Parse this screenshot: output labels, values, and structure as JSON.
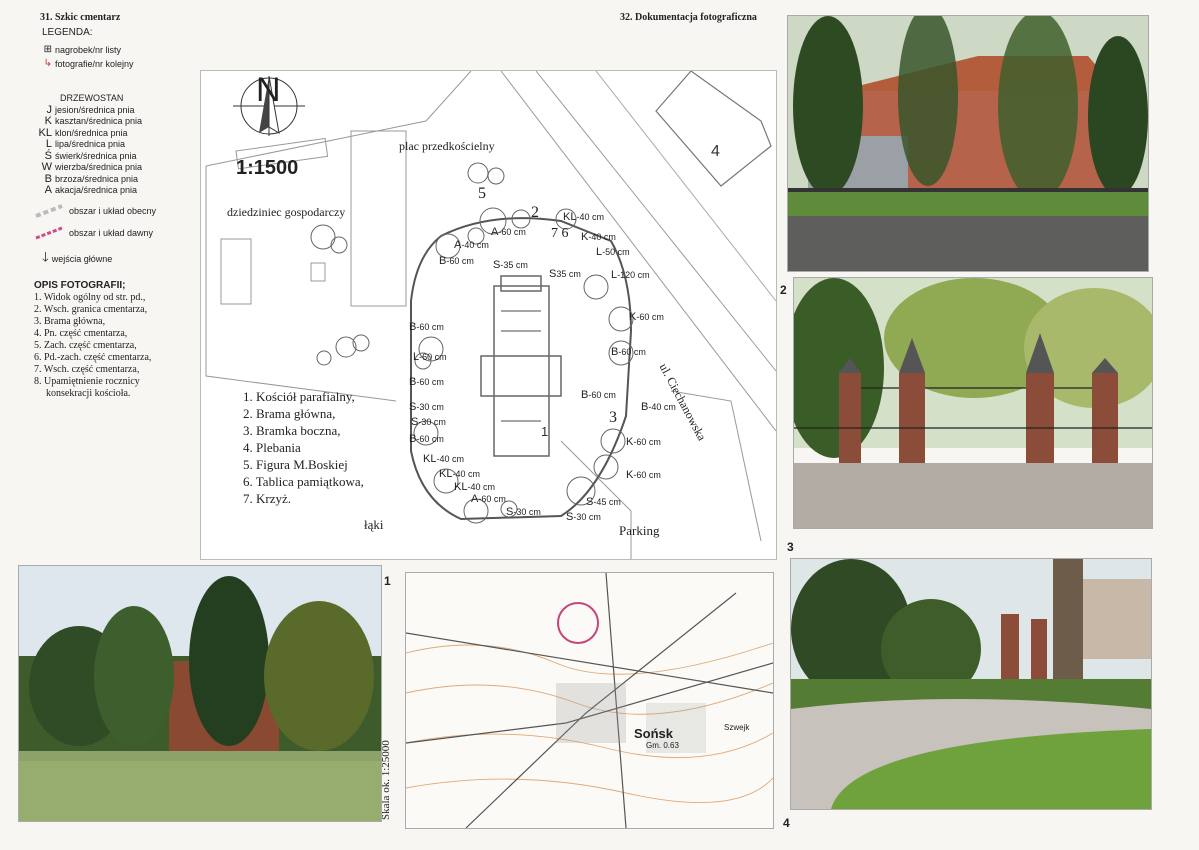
{
  "left_page": {
    "section_title": "31. Szkic cmentarz",
    "legend": {
      "title": "LEGENDA:",
      "items": [
        {
          "key": "⊞",
          "label": "nagrobek/nr listy"
        },
        {
          "key": "1",
          "label": "fotografie/nr kolejny"
        }
      ],
      "drzewostan_title": "DRZEWOSTAN",
      "trees": [
        {
          "key": "J",
          "label": "jesion/średnica pnia"
        },
        {
          "key": "K",
          "label": "kasztan/średnica pnia"
        },
        {
          "key": "KL",
          "label": "klon/średnica pnia"
        },
        {
          "key": "L",
          "label": "lipa/średnica pnia"
        },
        {
          "key": "Ś",
          "label": "świerk/średnica pnia"
        },
        {
          "key": "W",
          "label": "wierzba/średnica pnia"
        },
        {
          "key": "B",
          "label": "brzoza/średnica pnia"
        },
        {
          "key": "A",
          "label": "akacja/średnica pnia"
        }
      ],
      "area_current": "obszar i układ obecny",
      "area_old": "obszar i układ dawny",
      "main_entrance": "wejścia główne"
    },
    "opis": {
      "title": "OPIS FOTOGRAFII;",
      "items": [
        "1. Widok ogólny od str. pd.,",
        "2. Wsch. granica cmentarza,",
        "3. Brama główna,",
        "4. Pn. część cmentarza,",
        "5. Zach. część cmentarza,",
        "6. Pd.-zach. część cmentarza,",
        "7. Wsch. część cmentarza,",
        "8. Upamiętnienie rocznicy",
        "konsekracji kościoła."
      ]
    }
  },
  "sketch": {
    "north": "N",
    "scale": "1:1500",
    "plac": "plac przedkościelny",
    "dziedziniec": "dziedziniec gospodarczy",
    "street": "ul. Ciechanowska",
    "parking": "Parking",
    "laki": "łąki",
    "building4": "4",
    "objects": [
      "1. Kościół parafialny,",
      "2. Brama główna,",
      "3. Bramka boczna,",
      "4. Plebania",
      "5. Figura M.Boskiej",
      "6. Tablica pamiątkowa,",
      "7. Krzyż."
    ],
    "trees": [
      {
        "t": "KL",
        "d": "-40 cm"
      },
      {
        "t": "K",
        "d": "-40 cm"
      },
      {
        "t": "L",
        "d": "-50 cm"
      },
      {
        "t": "L",
        "d": "-120 cm"
      },
      {
        "t": "K",
        "d": "-60 cm"
      },
      {
        "t": "B",
        "d": "-60 cm"
      },
      {
        "t": "B",
        "d": "-60 cm"
      },
      {
        "t": "B",
        "d": "-40 cm"
      },
      {
        "t": "K",
        "d": "-60 cm"
      },
      {
        "t": "K",
        "d": "-60 cm"
      },
      {
        "t": "S",
        "d": "-45 cm"
      },
      {
        "t": "S",
        "d": "-30 cm"
      },
      {
        "t": "S",
        "d": "-30 cm"
      },
      {
        "t": "A",
        "d": "-60 cm"
      },
      {
        "t": "KL",
        "d": "-40 cm"
      },
      {
        "t": "KL",
        "d": "-40 cm"
      },
      {
        "t": "KL",
        "d": "-40 cm"
      },
      {
        "t": "B",
        "d": "-60 cm"
      },
      {
        "t": "S",
        "d": "-30 cm"
      },
      {
        "t": "S",
        "d": "-30 cm"
      },
      {
        "t": "B",
        "d": "-60 cm"
      },
      {
        "t": "L",
        "d": "-60 cm"
      },
      {
        "t": "B",
        "d": "-60 cm"
      },
      {
        "t": "B",
        "d": "-60 cm"
      },
      {
        "t": "A",
        "d": "-60 cm"
      },
      {
        "t": "A",
        "d": "-40 cm"
      },
      {
        "t": "S",
        "d": "-35 cm"
      },
      {
        "t": "S",
        "d": "35 cm"
      }
    ]
  },
  "topo": {
    "town": "Sońsk",
    "gm": "Gm. 0.63",
    "scale_label": "Skala ok. 1:25000",
    "szwejk": "Szwejk"
  },
  "right_page": {
    "section_title": "32. Dokumentacja fotograficzna",
    "photo_numbers": [
      "1",
      "2",
      "3",
      "4"
    ]
  }
}
